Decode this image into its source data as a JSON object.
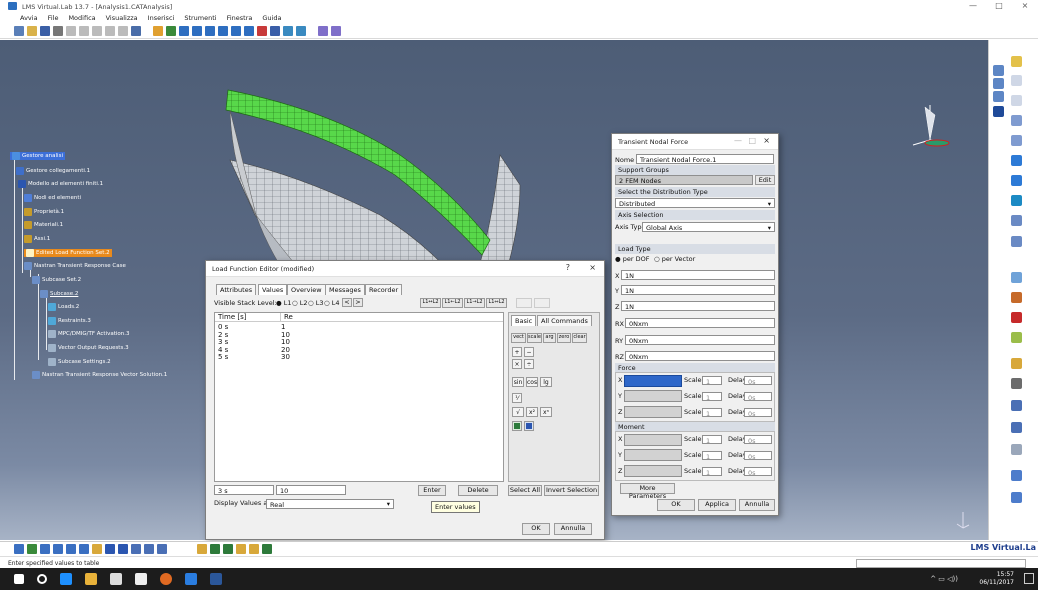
{
  "window": {
    "title": "LMS Virtual.Lab 13.7 - [Analysis1.CATAnalysis]",
    "controls": [
      "—",
      "□",
      "×"
    ]
  },
  "menu": {
    "items": [
      "Avvia",
      "File",
      "Modifica",
      "Visualizza",
      "Inserisci",
      "Strumenti",
      "Finestra",
      "Guida"
    ]
  },
  "tree": {
    "items": [
      {
        "label": "Gestore analisi",
        "style": "selected"
      },
      {
        "label": "Gestore collegamenti.1"
      },
      {
        "label": "Modello ad elementi finiti.1"
      },
      {
        "label": "Nodi ed elementi"
      },
      {
        "label": "Proprietà.1"
      },
      {
        "label": "Materiali.1"
      },
      {
        "label": "Assi.1"
      },
      {
        "label": "Edited Load Function Set.2",
        "style": "highlight"
      },
      {
        "label": "Nastran Transient Response Case"
      },
      {
        "label": "Subcase Set.2"
      },
      {
        "label": "Subcase.2"
      },
      {
        "label": "Loads.2"
      },
      {
        "label": "Restraints.3"
      },
      {
        "label": "MPC/DMIG/TF Activation.3"
      },
      {
        "label": "Vector Output Requests.3"
      },
      {
        "label": "Subcase Settings.2"
      },
      {
        "label": "Nastran Transient Response Vector Solution.1"
      }
    ]
  },
  "load_editor": {
    "title": "Load Function Editor (modified)",
    "help": "?",
    "close": "×",
    "tabs": [
      "Attributes",
      "Values",
      "Overview",
      "Messages",
      "Recorder"
    ],
    "stack_label": "Visible Stack Level:",
    "stack_levels": [
      "L1",
      "L2",
      "L3",
      "L4"
    ],
    "table": {
      "columns": [
        "Time [s]",
        "Re"
      ],
      "rows": [
        [
          "0 s",
          "1"
        ],
        [
          "2 s",
          "10"
        ],
        [
          "3 s",
          "10"
        ],
        [
          "4 s",
          "20"
        ],
        [
          "5 s",
          "30"
        ]
      ]
    },
    "top_keys": [
      "L1↔L2",
      "L1←L2",
      "L1→L2",
      "L1⇔L2"
    ],
    "calc_tabs": [
      "Basic",
      "All Commands"
    ],
    "calc_row1": [
      "vect",
      "scale",
      "arg",
      "zero",
      "clear"
    ],
    "ops": [
      "+",
      "−",
      "×",
      "÷"
    ],
    "funcs": [
      "sin",
      "cos",
      "lg"
    ],
    "funcs2": [
      "√",
      "x²",
      "xⁿ"
    ],
    "entry_time": "3 s",
    "entry_value": "10",
    "enter_label": "Enter",
    "delete_label": "Delete",
    "select_all_label": "Select All",
    "invert_label": "Invert Selection",
    "display_label": "Display Values as",
    "display_value": "Real",
    "tooltip": "Enter values",
    "ok_label": "OK",
    "cancel_label": "Annulla"
  },
  "nodal_force": {
    "title": "Transient Nodal Force",
    "nome_label": "Nome",
    "nome_value": "Transient Nodal Force.1",
    "support_groups_label": "Support Groups",
    "support_value": "2 FEM Nodes",
    "edit_label": "Edit",
    "distribution_label": "Select the Distribution Type",
    "distribution_value": "Distributed",
    "axis_selection_label": "Axis Selection",
    "axis_type_label": "Axis Type",
    "axis_type_value": "Global Axis",
    "load_type_label": "Load Type",
    "load_type_options": [
      "per DOF",
      "per Vector"
    ],
    "dof": [
      {
        "label": "X",
        "value": "1N"
      },
      {
        "label": "Y",
        "value": "1N"
      },
      {
        "label": "Z",
        "value": "1N"
      },
      {
        "label": "RX",
        "value": "0Nxm"
      },
      {
        "label": "RY",
        "value": "0Nxm"
      },
      {
        "label": "RZ",
        "value": "0Nxm"
      }
    ],
    "force_label": "Force",
    "moment_label": "Moment",
    "axes": [
      "X",
      "Y",
      "Z"
    ],
    "scale_label": "Scale",
    "scale_value": "1",
    "delay_label": "Delay",
    "delay_value": "0s",
    "more_label": "More Parameters",
    "ok_label": "OK",
    "apply_label": "Applica",
    "cancel_label": "Annulla"
  },
  "status": {
    "hint": "Enter specified values to table",
    "brand": "LMS Virtual.La",
    "time": "15:57",
    "date": "06/11/2017"
  }
}
